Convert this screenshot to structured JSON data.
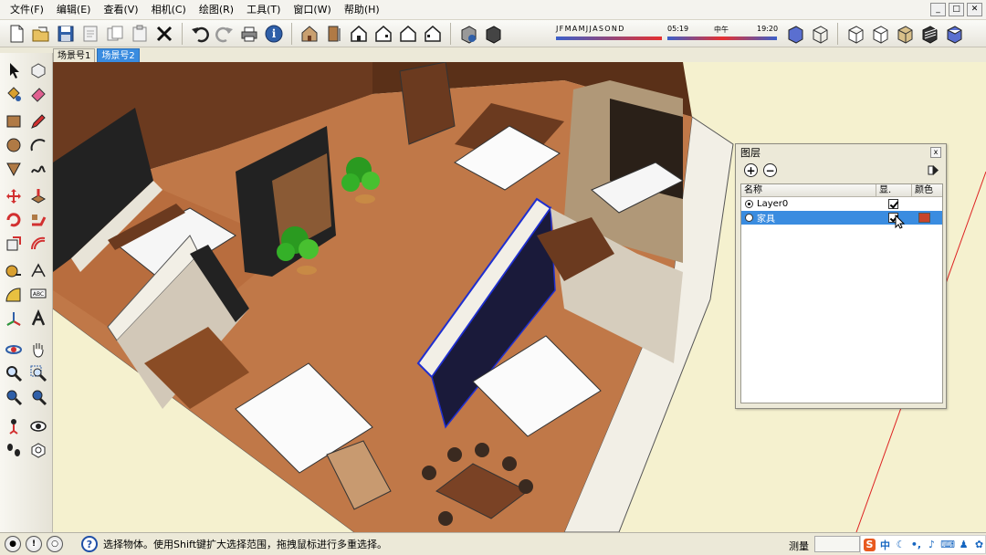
{
  "menu": [
    "文件(F)",
    "编辑(E)",
    "查看(V)",
    "相机(C)",
    "绘图(R)",
    "工具(T)",
    "窗口(W)",
    "帮助(H)"
  ],
  "window_controls": {
    "minimize": "_",
    "restore": "□",
    "close": "✕"
  },
  "shadow": {
    "months": [
      "J",
      "F",
      "M",
      "A",
      "M",
      "J",
      "J",
      "A",
      "S",
      "O",
      "N",
      "D"
    ],
    "time_start": "05:19",
    "time_mid": "中午",
    "time_end": "19:20"
  },
  "scene_tabs": [
    {
      "label": "场景号1",
      "active": false
    },
    {
      "label": "场景号2",
      "active": true
    }
  ],
  "layers_panel": {
    "title": "图层",
    "close_glyph": "x",
    "add_glyph": "+",
    "remove_glyph": "−",
    "columns": {
      "name": "名称",
      "visible": "显.",
      "color": "颜色"
    },
    "layers": [
      {
        "name": "Layer0",
        "active": true,
        "visible": true,
        "selected": false,
        "color": ""
      },
      {
        "name": "家具",
        "active": false,
        "visible": true,
        "selected": true,
        "color": "#c8452b"
      }
    ]
  },
  "status": {
    "message": "选择物体。使用Shift键扩大选择范围，拖拽鼠标进行多重选择。",
    "help_glyph": "?",
    "measure_label": "测量"
  },
  "ime": {
    "logo": "S",
    "lang": "中"
  },
  "colors": {
    "accent": "#3a8ce0",
    "floor": "#c07848",
    "wall": "#6b3a1f"
  }
}
